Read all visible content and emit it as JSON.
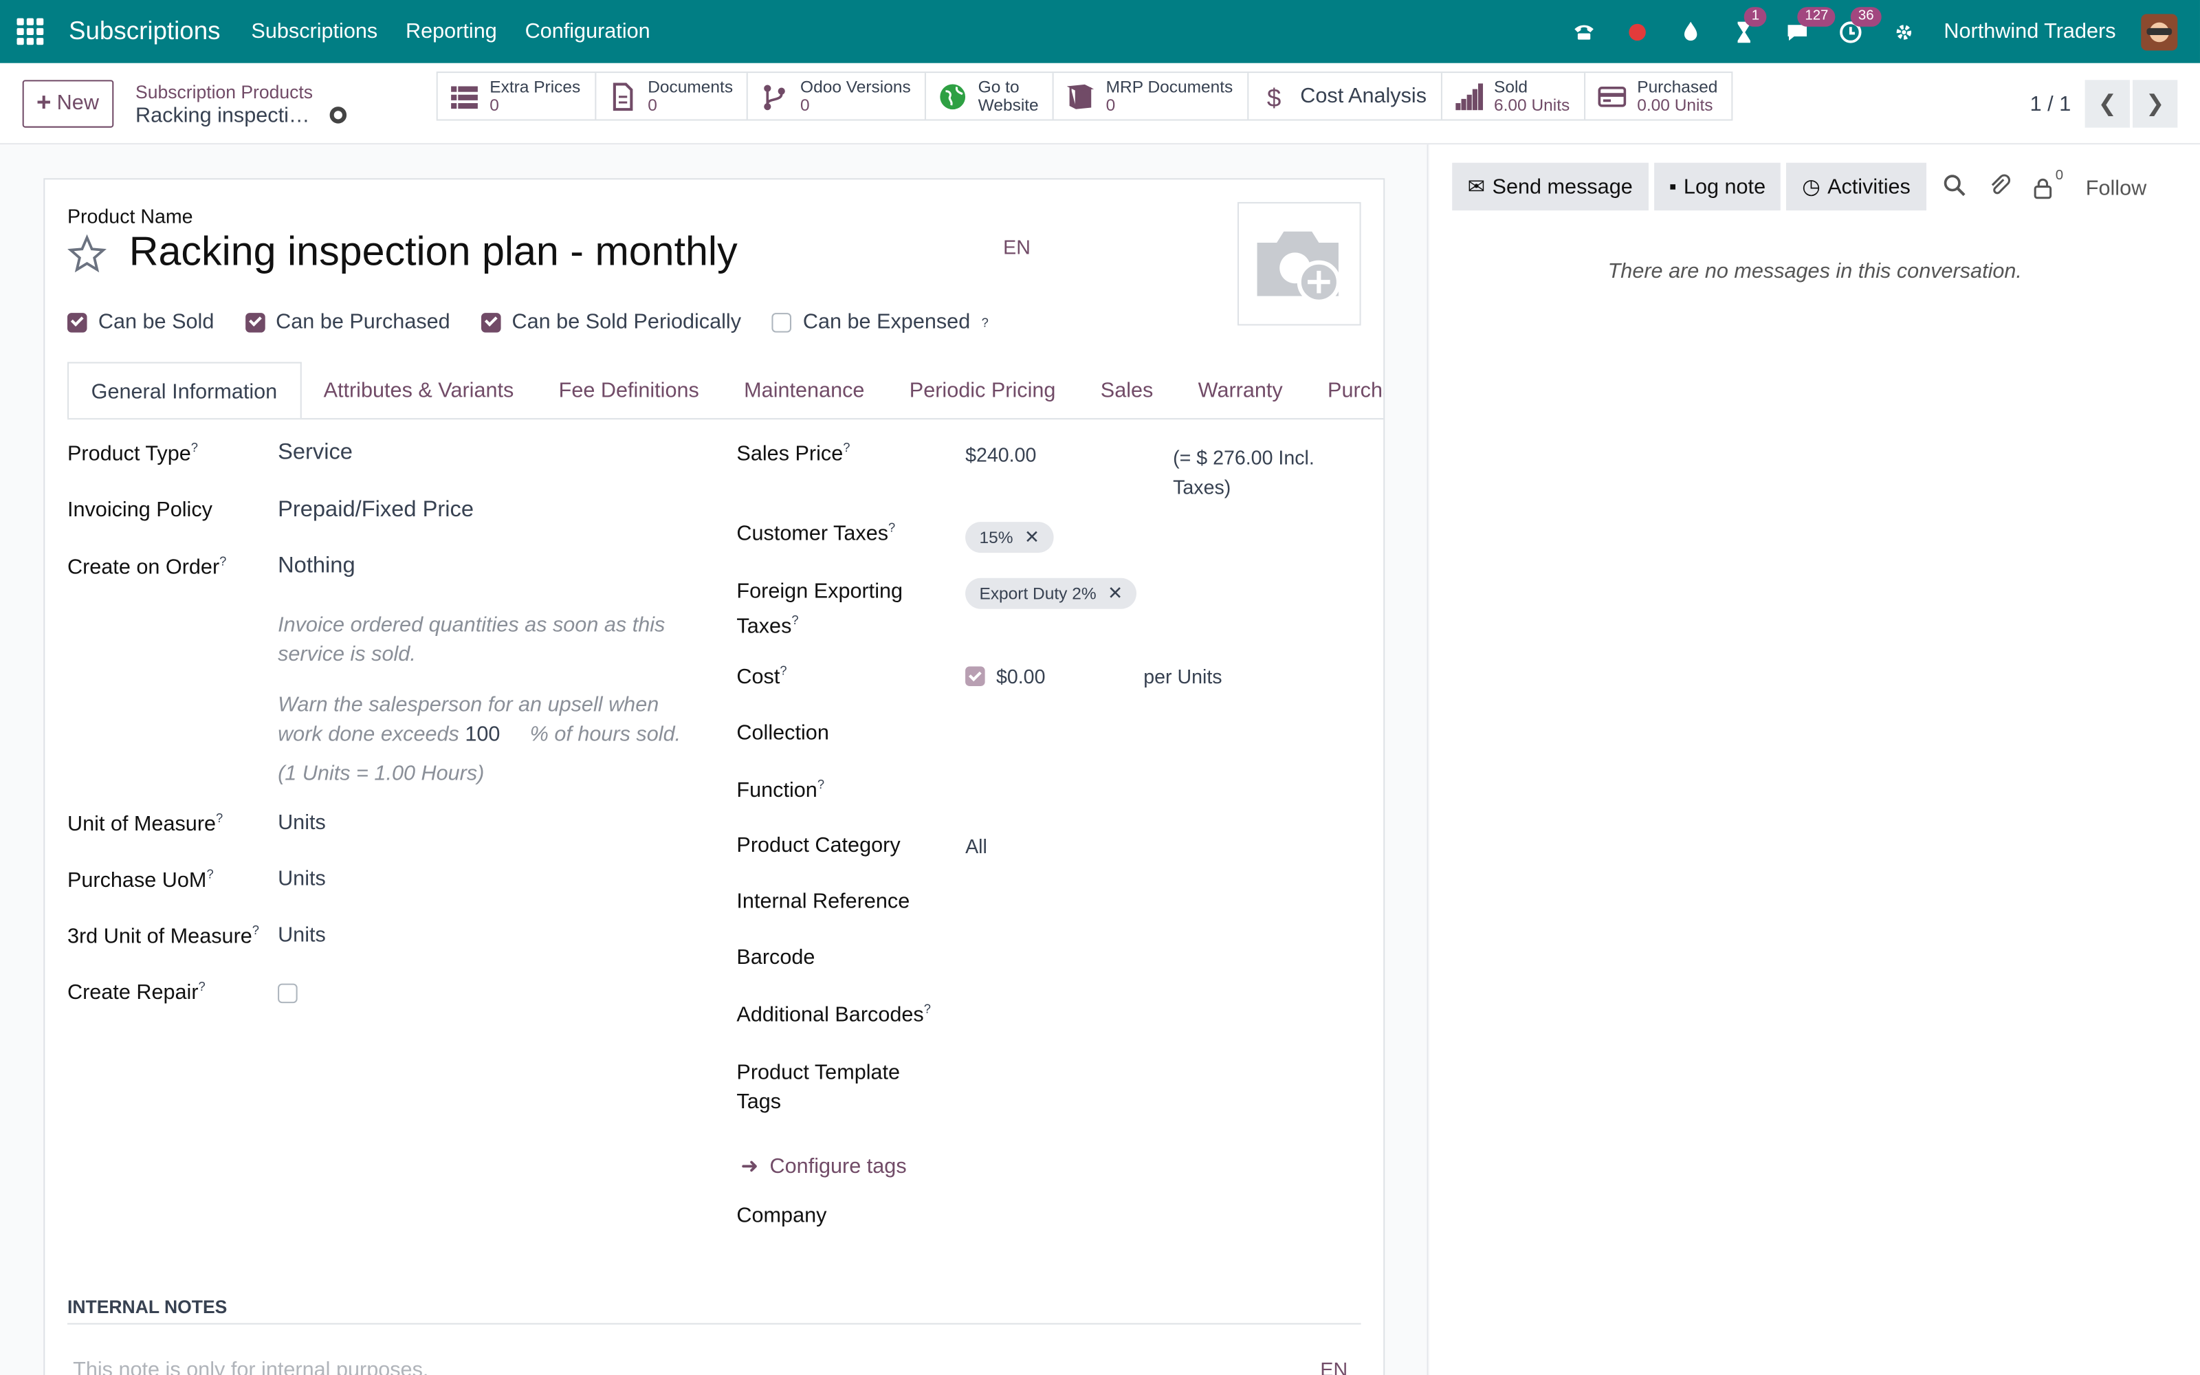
{
  "navbar": {
    "brand": "Subscriptions",
    "menu": [
      "Subscriptions",
      "Reporting",
      "Configuration"
    ],
    "activity_badge": "1",
    "messages_badge": "127",
    "clock_badge": "36",
    "company": "Northwind Traders"
  },
  "control": {
    "new_label": "New",
    "breadcrumb_parent": "Subscription Products",
    "breadcrumb_current": "Racking inspecti…",
    "pager": "1 / 1"
  },
  "smart_buttons": [
    {
      "label": "Extra Prices",
      "value": "0",
      "icon": "list-icon"
    },
    {
      "label": "Documents",
      "value": "0",
      "icon": "document-icon"
    },
    {
      "label": "Odoo Versions",
      "value": "0",
      "icon": "branch-icon"
    },
    {
      "label": "Go to",
      "value": "Website",
      "icon": "globe-icon"
    },
    {
      "label": "MRP Documents",
      "value": "0",
      "icon": "book-icon"
    },
    {
      "label": "Cost Analysis",
      "value": "",
      "icon": "dollar-icon"
    },
    {
      "label": "Sold",
      "value": "6.00 Units",
      "icon": "bar-chart-icon"
    },
    {
      "label": "Purchased",
      "value": "0.00 Units",
      "icon": "credit-card-icon"
    }
  ],
  "form": {
    "product_name_label": "Product Name",
    "product_name": "Racking inspection plan - monthly",
    "lang": "EN",
    "checkboxes": [
      {
        "label": "Can be Sold",
        "checked": true
      },
      {
        "label": "Can be Purchased",
        "checked": true
      },
      {
        "label": "Can be Sold Periodically",
        "checked": true
      },
      {
        "label": "Can be Expensed",
        "checked": false
      }
    ],
    "tabs": [
      "General Information",
      "Attributes & Variants",
      "Fee Definitions",
      "Maintenance",
      "Periodic Pricing",
      "Sales",
      "Warranty",
      "Purchase"
    ],
    "left": {
      "product_type_label": "Product Type",
      "product_type": "Service",
      "invoicing_policy_label": "Invoicing Policy",
      "invoicing_policy": "Prepaid/Fixed Price",
      "create_on_order_label": "Create on Order",
      "create_on_order": "Nothing",
      "help1_line1": "Invoice ordered quantities as soon as this",
      "help1_line2": "service is sold.",
      "help2_line1": "Warn the salesperson for an upsell when",
      "help2_line2a": "work done exceeds",
      "help2_value": "100",
      "help2_line2b": "% of hours sold.",
      "uom_ratio": "(1 Units = 1.00 Hours)",
      "uom_label": "Unit of Measure",
      "uom": "Units",
      "purchase_uom_label": "Purchase UoM",
      "purchase_uom": "Units",
      "third_uom_label": "3rd Unit of Measure",
      "third_uom": "Units",
      "create_repair_label": "Create Repair"
    },
    "right": {
      "sales_price_label": "Sales Price",
      "sales_price": "$240.00",
      "incl_taxes_line1": "(= $ 276.00 Incl.",
      "incl_taxes_line2": "Taxes)",
      "customer_taxes_label": "Customer Taxes",
      "customer_tax": "15%",
      "foreign_taxes_label_1": "Foreign Exporting",
      "foreign_taxes_label_2": "Taxes",
      "foreign_tax": "Export Duty 2%",
      "cost_label": "Cost",
      "cost": "$0.00",
      "cost_unit": "per Units",
      "collection_label": "Collection",
      "function_label": "Function",
      "category_label": "Product Category",
      "category": "All",
      "internal_ref_label": "Internal Reference",
      "barcode_label": "Barcode",
      "additional_barcodes_label": "Additional Barcodes",
      "template_tags_label_1": "Product Template",
      "template_tags_label_2": "Tags",
      "configure_tags": "Configure tags",
      "company_label": "Company"
    },
    "internal_notes_title": "INTERNAL NOTES",
    "internal_notes_placeholder": "This note is only for internal purposes.",
    "notes_lang": "EN"
  },
  "chatter": {
    "send_message": "Send message",
    "log_note": "Log note",
    "activities": "Activities",
    "followers_count": "0",
    "follow": "Follow",
    "empty": "There are no messages in this conversation."
  },
  "colors": {
    "navbar": "#017e84",
    "accent": "#714b67"
  }
}
